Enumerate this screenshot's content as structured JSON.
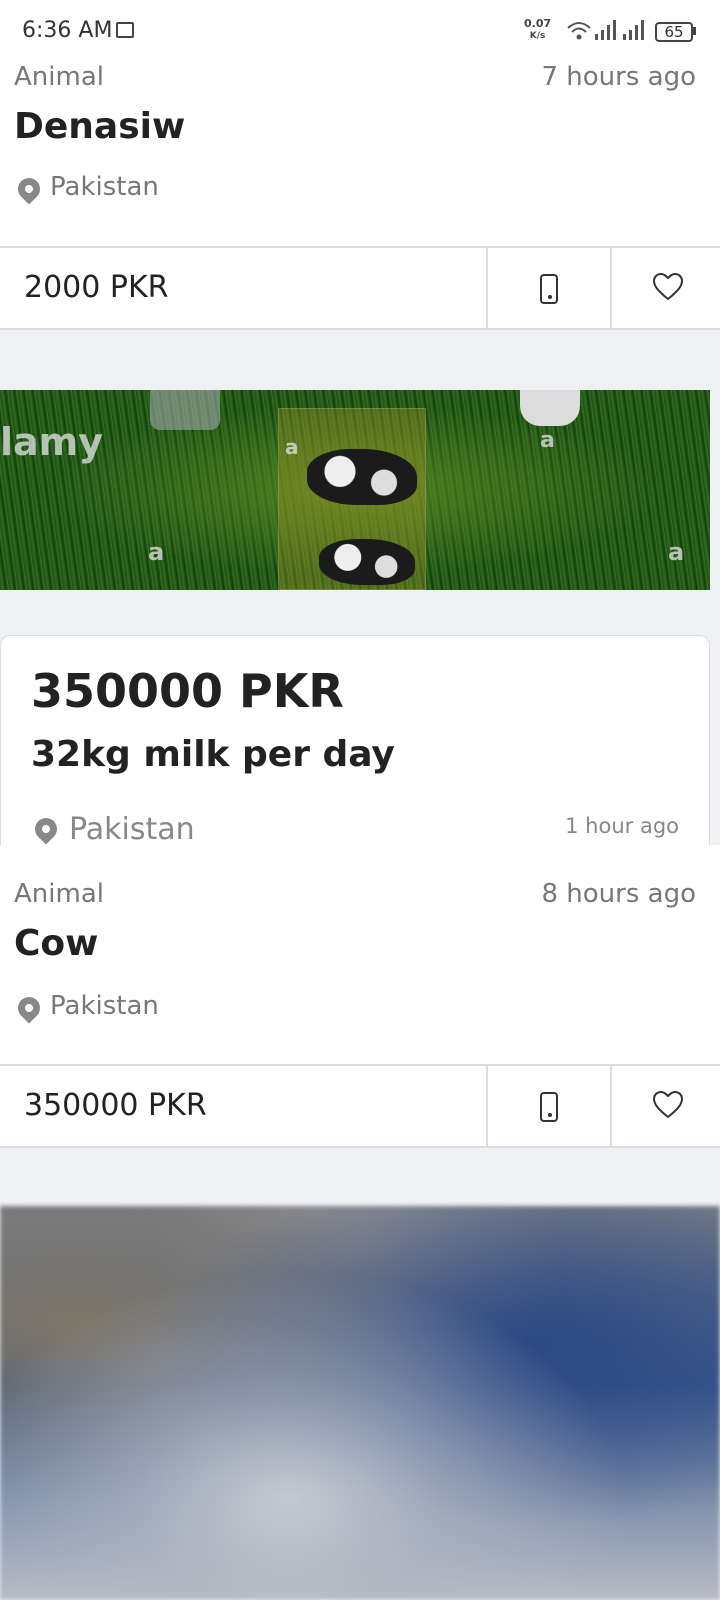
{
  "status_bar": {
    "time": "6:36 AM",
    "net_speed_value": "0.07",
    "net_speed_unit": "K/s",
    "battery": "65"
  },
  "listings": [
    {
      "category": "Animal",
      "time_ago": "7 hours ago",
      "title": "Denasiw",
      "location": "Pakistan",
      "price": "2000 PKR"
    },
    {
      "category": "Animal",
      "time_ago": "8 hours ago",
      "title": "Cow",
      "location": "Pakistan",
      "price": "350000 PKR"
    }
  ],
  "featured": {
    "price": "350000 PKR",
    "title": "32kg milk per day",
    "location": "Pakistan",
    "time_ago": "1 hour ago",
    "image_watermark": "lamy",
    "image_letters": [
      "a",
      "a",
      "a",
      "a"
    ]
  },
  "icons": {
    "location": "location-pin-icon",
    "phone": "phone-icon",
    "favorite": "heart-icon"
  },
  "colors": {
    "page_bg": "#f0f1f4",
    "card_bg": "#ffffff",
    "text_primary": "#222222",
    "text_secondary": "#777777"
  }
}
